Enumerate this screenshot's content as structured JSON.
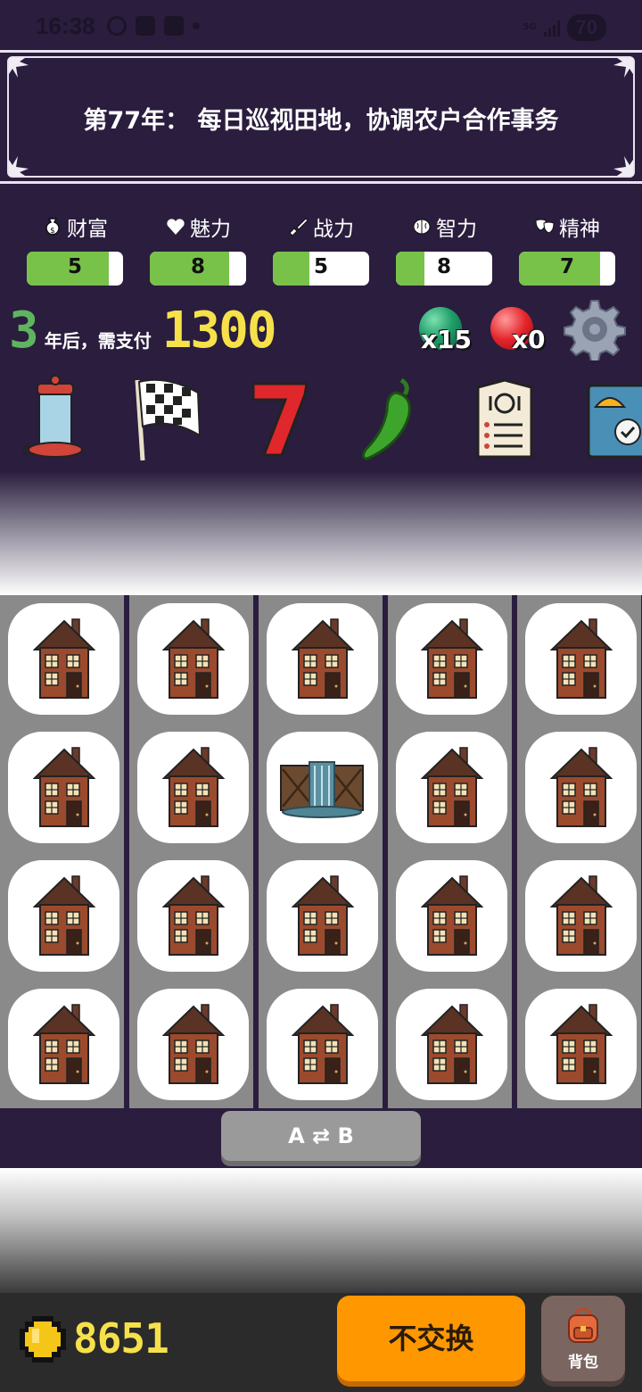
{
  "status_bar": {
    "time": "16:38",
    "network": "5G",
    "battery": "70"
  },
  "banner": {
    "title": "第77年： 每日巡视田地，协调农户合作事务"
  },
  "stats": [
    {
      "icon": "money-bag-icon",
      "label": "财富",
      "value": "5",
      "fill_fraction": 0.85
    },
    {
      "icon": "heart-icon",
      "label": "魅力",
      "value": "8",
      "fill_fraction": 0.82
    },
    {
      "icon": "sword-icon",
      "label": "战力",
      "value": "5",
      "fill_fraction": 0.38
    },
    {
      "icon": "brain-icon",
      "label": "智力",
      "value": "8",
      "fill_fraction": 0.3
    },
    {
      "icon": "theater-masks-icon",
      "label": "精神",
      "value": "7",
      "fill_fraction": 0.84
    }
  ],
  "rent": {
    "years": "3",
    "text": "年后，需支付",
    "amount": "1300"
  },
  "currencies": {
    "green_orb_count": "x15",
    "red_orb_count": "x0"
  },
  "items": [
    "lantern-icon",
    "checkered-flag-icon",
    "lucky-seven-icon",
    "chili-pepper-icon",
    "menu-card-icon",
    "blueprint-icon"
  ],
  "grid": {
    "columns": 5,
    "rows": 4,
    "cells": [
      "house",
      "house",
      "house",
      "house",
      "house",
      "house",
      "house",
      "waterfall",
      "house",
      "house",
      "house",
      "house",
      "house",
      "house",
      "house",
      "house",
      "house",
      "house",
      "house",
      "house"
    ]
  },
  "swap_button": {
    "label": "A ⇄ B"
  },
  "bottom": {
    "coins": "8651",
    "no_swap_label": "不交换",
    "bag_label": "背包"
  },
  "colors": {
    "background": "#2a1d3e",
    "stat_fill": "#79c24a",
    "rent_years": "#5fb55f",
    "rent_amount": "#f6e14a",
    "no_swap": "#ff9800"
  }
}
